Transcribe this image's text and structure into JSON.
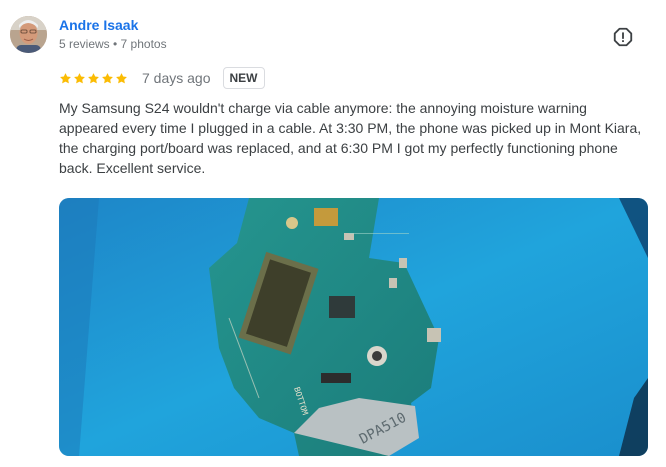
{
  "review": {
    "author": {
      "name": "Andre Isaak",
      "meta": "5 reviews • 7 photos"
    },
    "rating": 5,
    "date": "7 days ago",
    "badge": "NEW",
    "text": "My Samsung S24 wouldn't charge via cable anymore: the annoying moisture warning appeared every time I plugged in a cable. At 3:30 PM, the phone was picked up in Mont Kiara, the charging port/board was replaced, and at 6:30 PM I got my perfectly functioning phone back. Excellent service.",
    "photo": {
      "board_markings": [
        "BOTTOM",
        "DPA510"
      ]
    }
  },
  "icons": {
    "report": "report-icon",
    "star": "star-icon"
  },
  "colors": {
    "author_link": "#1a73e8",
    "star": "#fbbc04",
    "mat_blue": "#1e9ad6",
    "pcb_green": "#1f8a86"
  }
}
